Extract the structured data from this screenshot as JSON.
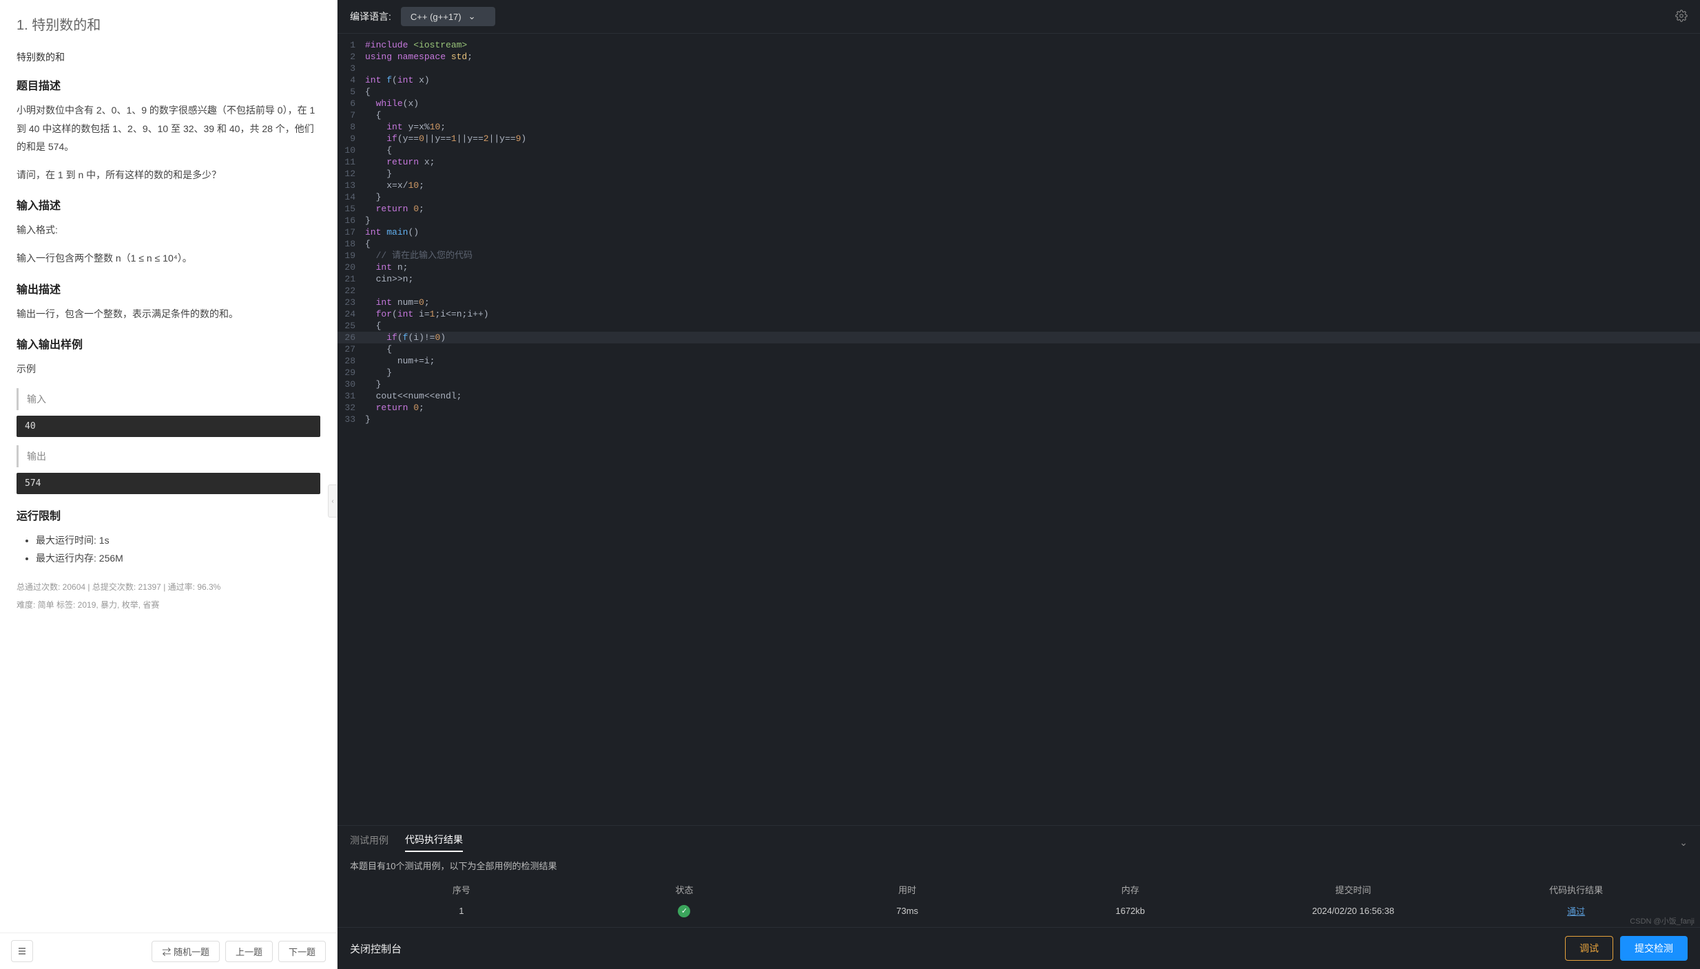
{
  "problem": {
    "number_title": "1. 特别数的和",
    "subtitle": "特别数的和",
    "sections": {
      "desc_h": "题目描述",
      "desc_p1": "小明对数位中含有 2、0、1、9 的数字很感兴趣（不包括前导 0），在 1 到 40 中这样的数包括 1、2、9、10 至 32、39 和 40，共 28 个，他们的和是 574。",
      "desc_p2": "请问，在 1 到 n 中，所有这样的数的和是多少？",
      "input_h": "输入描述",
      "input_p1": "输入格式:",
      "input_p2": "输入一行包含两个整数 n（1 ≤ n ≤ 10⁴）。",
      "output_h": "输出描述",
      "output_p1": "输出一行，包含一个整数，表示满足条件的数的和。",
      "sample_h": "输入输出样例",
      "sample_label": "示例",
      "in_label": "输入",
      "in_val": "40",
      "out_label": "输出",
      "out_val": "574",
      "limits_h": "运行限制",
      "limit_time": "最大运行时间: 1s",
      "limit_mem": "最大运行内存: 256M"
    },
    "stats_line1": "总通过次数: 20604  |  总提交次数: 21397  |  通过率: 96.3%",
    "stats_line2": "难度: 简单    标签: 2019, 暴力, 枚举, 省赛"
  },
  "footer_nav": {
    "random": "⇄ 随机一题",
    "prev": "上一题",
    "next": "下一题"
  },
  "editor": {
    "lang_label": "编译语言:",
    "lang_value": "C++ (g++17)",
    "current_line": 26,
    "code_lines": [
      [
        [
          "kw",
          "#include "
        ],
        [
          "inc",
          "<iostream>"
        ]
      ],
      [
        [
          "kw",
          "using "
        ],
        [
          "kw",
          "namespace "
        ],
        [
          "ns",
          "std"
        ],
        [
          "op",
          ";"
        ]
      ],
      [],
      [
        [
          "type",
          "int "
        ],
        [
          "fn",
          "f"
        ],
        [
          "op",
          "("
        ],
        [
          "type",
          "int "
        ],
        [
          "id",
          "x"
        ],
        [
          "op",
          ")"
        ]
      ],
      [
        [
          "op",
          "{"
        ]
      ],
      [
        [
          "op",
          "  "
        ],
        [
          "kw",
          "while"
        ],
        [
          "op",
          "("
        ],
        [
          "id",
          "x"
        ],
        [
          "op",
          ")"
        ]
      ],
      [
        [
          "op",
          "  {"
        ]
      ],
      [
        [
          "op",
          "    "
        ],
        [
          "type",
          "int "
        ],
        [
          "id",
          "y"
        ],
        [
          "op",
          "="
        ],
        [
          "id",
          "x"
        ],
        [
          "op",
          "%"
        ],
        [
          "num",
          "10"
        ],
        [
          "op",
          ";"
        ]
      ],
      [
        [
          "op",
          "    "
        ],
        [
          "kw",
          "if"
        ],
        [
          "op",
          "("
        ],
        [
          "id",
          "y"
        ],
        [
          "op",
          "=="
        ],
        [
          "num",
          "0"
        ],
        [
          "op",
          "||"
        ],
        [
          "id",
          "y"
        ],
        [
          "op",
          "=="
        ],
        [
          "num",
          "1"
        ],
        [
          "op",
          "||"
        ],
        [
          "id",
          "y"
        ],
        [
          "op",
          "=="
        ],
        [
          "num",
          "2"
        ],
        [
          "op",
          "||"
        ],
        [
          "id",
          "y"
        ],
        [
          "op",
          "=="
        ],
        [
          "num",
          "9"
        ],
        [
          "op",
          ")"
        ]
      ],
      [
        [
          "op",
          "    {"
        ]
      ],
      [
        [
          "op",
          "    "
        ],
        [
          "kw",
          "return "
        ],
        [
          "id",
          "x"
        ],
        [
          "op",
          ";"
        ]
      ],
      [
        [
          "op",
          "    }"
        ]
      ],
      [
        [
          "op",
          "    "
        ],
        [
          "id",
          "x"
        ],
        [
          "op",
          "="
        ],
        [
          "id",
          "x"
        ],
        [
          "op",
          "/"
        ],
        [
          "num",
          "10"
        ],
        [
          "op",
          ";"
        ]
      ],
      [
        [
          "op",
          "  }"
        ]
      ],
      [
        [
          "op",
          "  "
        ],
        [
          "kw",
          "return "
        ],
        [
          "num",
          "0"
        ],
        [
          "op",
          ";"
        ]
      ],
      [
        [
          "op",
          "}"
        ]
      ],
      [
        [
          "type",
          "int "
        ],
        [
          "fn",
          "main"
        ],
        [
          "op",
          "()"
        ]
      ],
      [
        [
          "op",
          "{"
        ]
      ],
      [
        [
          "op",
          "  "
        ],
        [
          "cmt",
          "// 请在此输入您的代码"
        ]
      ],
      [
        [
          "op",
          "  "
        ],
        [
          "type",
          "int "
        ],
        [
          "id",
          "n"
        ],
        [
          "op",
          ";"
        ]
      ],
      [
        [
          "op",
          "  "
        ],
        [
          "id",
          "cin"
        ],
        [
          "op",
          ">>"
        ],
        [
          "id",
          "n"
        ],
        [
          "op",
          ";"
        ]
      ],
      [],
      [
        [
          "op",
          "  "
        ],
        [
          "type",
          "int "
        ],
        [
          "id",
          "num"
        ],
        [
          "op",
          "="
        ],
        [
          "num",
          "0"
        ],
        [
          "op",
          ";"
        ]
      ],
      [
        [
          "op",
          "  "
        ],
        [
          "kw",
          "for"
        ],
        [
          "op",
          "("
        ],
        [
          "type",
          "int "
        ],
        [
          "id",
          "i"
        ],
        [
          "op",
          "="
        ],
        [
          "num",
          "1"
        ],
        [
          "op",
          ";"
        ],
        [
          "id",
          "i"
        ],
        [
          "op",
          "<="
        ],
        [
          "id",
          "n"
        ],
        [
          "op",
          ";"
        ],
        [
          "id",
          "i"
        ],
        [
          "op",
          "++)"
        ]
      ],
      [
        [
          "op",
          "  {"
        ]
      ],
      [
        [
          "op",
          "    "
        ],
        [
          "kw",
          "if"
        ],
        [
          "op",
          "("
        ],
        [
          "fn",
          "f"
        ],
        [
          "op",
          "("
        ],
        [
          "id",
          "i"
        ],
        [
          "op",
          ")!="
        ],
        [
          "num",
          "0"
        ],
        [
          "op",
          ")"
        ]
      ],
      [
        [
          "op",
          "    {"
        ]
      ],
      [
        [
          "op",
          "      "
        ],
        [
          "id",
          "num"
        ],
        [
          "op",
          "+="
        ],
        [
          "id",
          "i"
        ],
        [
          "op",
          ";"
        ]
      ],
      [
        [
          "op",
          "    }"
        ]
      ],
      [
        [
          "op",
          "  }"
        ]
      ],
      [
        [
          "op",
          "  "
        ],
        [
          "id",
          "cout"
        ],
        [
          "op",
          "<<"
        ],
        [
          "id",
          "num"
        ],
        [
          "op",
          "<<"
        ],
        [
          "id",
          "endl"
        ],
        [
          "op",
          ";"
        ]
      ],
      [
        [
          "op",
          "  "
        ],
        [
          "kw",
          "return "
        ],
        [
          "num",
          "0"
        ],
        [
          "op",
          ";"
        ]
      ],
      [
        [
          "op",
          "}"
        ]
      ]
    ]
  },
  "results": {
    "tab_test": "测试用例",
    "tab_result": "代码执行结果",
    "desc": "本题目有10个测试用例，以下为全部用例的检测结果",
    "headers": [
      "序号",
      "状态",
      "用时",
      "内存",
      "提交时间",
      "代码执行结果"
    ],
    "rows": [
      {
        "seq": "1",
        "status": "ok",
        "time": "73ms",
        "mem": "1672kb",
        "submit": "2024/02/20 16:56:38",
        "result": "通过"
      }
    ]
  },
  "bottom": {
    "close": "关闭控制台",
    "debug": "调试",
    "submit": "提交检测"
  },
  "watermark": "CSDN @小饭_fanji"
}
